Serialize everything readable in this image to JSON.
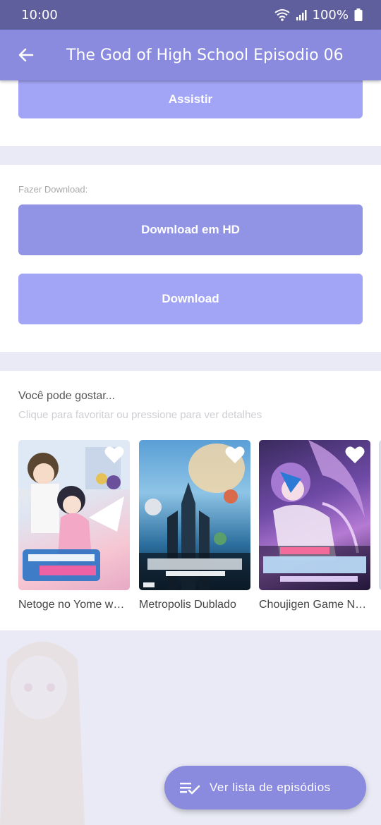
{
  "status": {
    "time": "10:00",
    "battery": "100%"
  },
  "appbar": {
    "title": "The God of High School Episodio 06"
  },
  "watch": {
    "label": "Assistir"
  },
  "download": {
    "section_label": "Fazer Download:",
    "hd_label": "Download em HD",
    "sd_label": "Download"
  },
  "recommend": {
    "title": "Você pode gostar...",
    "subtitle": "Clique para favoritar ou pressione para ver detalhes",
    "items": [
      {
        "title": "Netoge no Yome wa Onna no Ko ja Nai to Omotta?"
      },
      {
        "title": "Metropolis Dublado"
      },
      {
        "title": "Choujigen Game Neptune The Animation"
      }
    ]
  },
  "fab": {
    "label": "Ver lista de episódios"
  },
  "colors": {
    "primary": "#8a8bde",
    "statusbar": "#5e5f9c",
    "button_light": "#a2a4f6",
    "button_dark": "#9193e4"
  },
  "icons": [
    "back-arrow-icon",
    "wifi-icon",
    "signal-icon",
    "battery-icon",
    "heart-icon",
    "playlist-check-icon"
  ]
}
